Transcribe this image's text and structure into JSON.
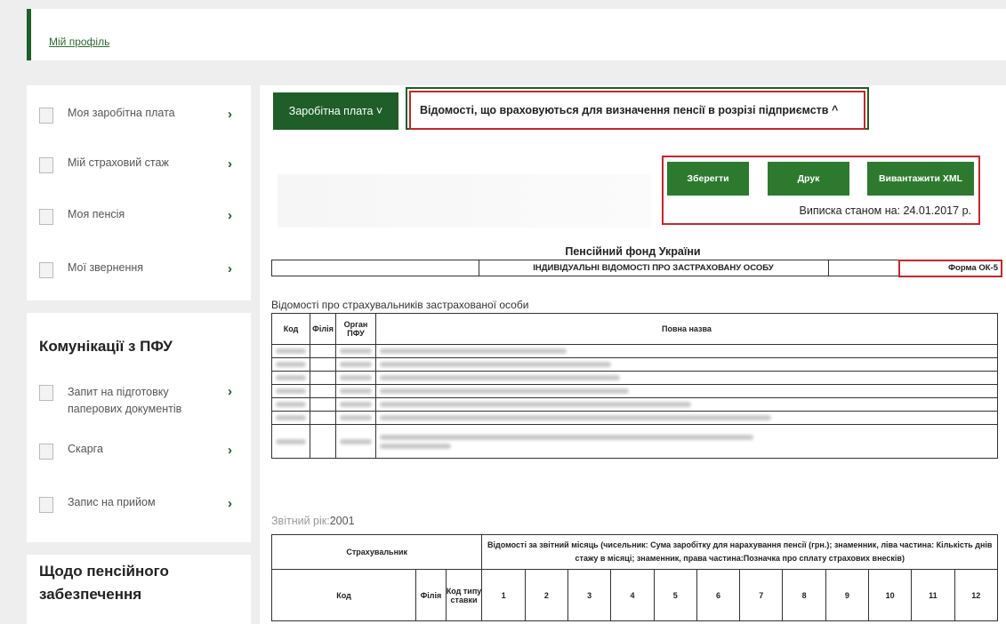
{
  "top": {
    "profile_link": "Мій профіль"
  },
  "sidebar": {
    "group1": [
      "Моя заробітна плата",
      "Мій страховий стаж",
      "Моя пенсія",
      "Мої звернення"
    ],
    "group2_title": "Комунікації з ПФУ",
    "group2": [
      "Запит на підготовку паперових документів",
      "Скарга",
      "Запис на прийом"
    ],
    "group3_title": "Щодо пенсійного забезпечення",
    "chevron": "›"
  },
  "tabs": {
    "salary": "Заробітна плата ˅",
    "details": "Відомості, що враховуються для визначення пенсії в розрізі підприємств ^"
  },
  "actions": {
    "save": "Зберегти",
    "print": "Друк",
    "export_xml": "Вивантажити XML",
    "statement": "Виписка станом на: 24.01.2017 р."
  },
  "doc": {
    "fund": "Пенсійний фонд України",
    "header_title": "ІНДИВІДУАЛЬНІ ВІДОМОСТІ ПРО ЗАСТРАХОВАНУ ОСОБУ",
    "form": "Форма ОК-5",
    "insurers_title": "Відомості про страхувальників застрахованої особи",
    "cols": [
      "Код",
      "Філія",
      "Орган ПФУ",
      "Повна назва"
    ],
    "year_label": "Звітний рік:",
    "year": "2001",
    "rt_insurer": "Страхувальник",
    "rt_months_header": "Відомості за звітний місяць (чисельник: Сума заробітку для нарахування пенсії (грн.); знаменник, ліва частина: Кількість днів стажу в місяці; знаменник, права частина:Позначка про сплату страхових внесків)",
    "rt_code": "Код",
    "rt_branch": "Філія",
    "rt_rate": "Код типу ставки",
    "months": [
      "1",
      "2",
      "3",
      "4",
      "5",
      "6",
      "7",
      "8",
      "9",
      "10",
      "11",
      "12"
    ]
  }
}
